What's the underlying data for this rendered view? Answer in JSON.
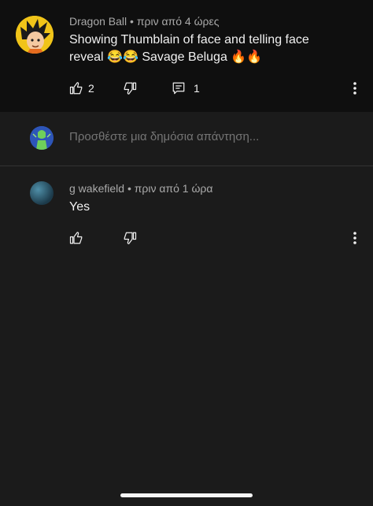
{
  "comments": [
    {
      "author": "Dragon Ball",
      "time": "πριν από 4 ώρες",
      "text": "Showing Thumblain of face and telling face reveal 😂😂 Savage Beluga 🔥🔥",
      "likes": "2",
      "replies": "1"
    },
    {
      "author": "g wakefield",
      "time": "πριν από 1 ώρα",
      "text": "Yes"
    }
  ],
  "reply_box": {
    "placeholder": "Προσθέστε μια δημόσια απάντηση..."
  },
  "icons": {
    "like": "thumb-up-icon",
    "dislike": "thumb-down-icon",
    "replies": "comment-icon",
    "more": "more-vertical-icon"
  }
}
